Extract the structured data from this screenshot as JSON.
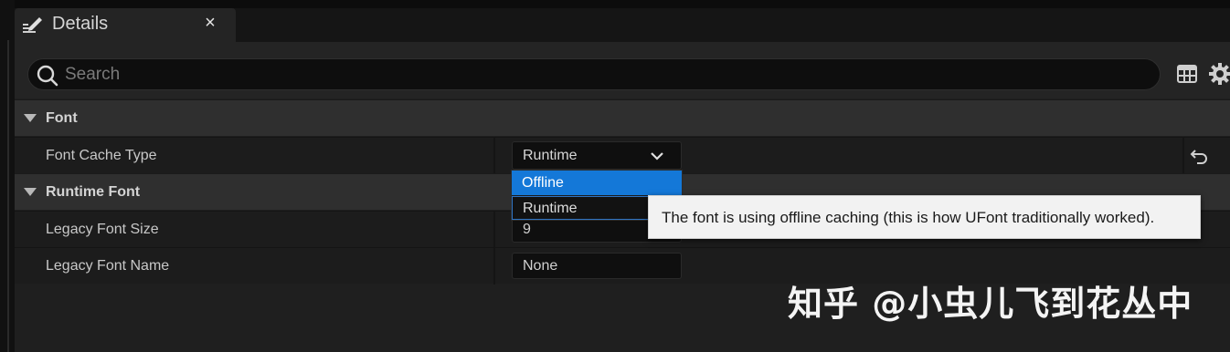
{
  "window": {
    "tab_title": "Details",
    "tab_icon": "pencil-icon",
    "close_glyph": "×"
  },
  "search": {
    "placeholder": "Search",
    "value": "",
    "icons": [
      "search-icon",
      "table-view-icon",
      "gear-icon"
    ]
  },
  "categories": [
    {
      "label": "Font",
      "properties": [
        {
          "label": "Font Cache Type",
          "value": "Runtime",
          "widget": "combo",
          "reset_icon": "reset-arrow-icon"
        }
      ]
    },
    {
      "label": "Runtime Font",
      "properties": [
        {
          "label": "Legacy Font Size",
          "value": "9",
          "widget": "number"
        },
        {
          "label": "Legacy Font Name",
          "value": "None",
          "widget": "text"
        }
      ]
    }
  ],
  "dropdown": {
    "options": [
      "Offline",
      "Runtime"
    ],
    "highlighted": "Offline",
    "selected": "Runtime"
  },
  "tooltip": {
    "text": "The font is using offline caching (this is how UFont traditionally worked)."
  },
  "watermark": {
    "text": "知乎 @小虫儿飞到花丛中"
  },
  "colors": {
    "accent": "#1478d8",
    "panel": "#1f1f1f",
    "category": "#2f2f2f",
    "tooltip_bg": "#f2f2f2"
  }
}
